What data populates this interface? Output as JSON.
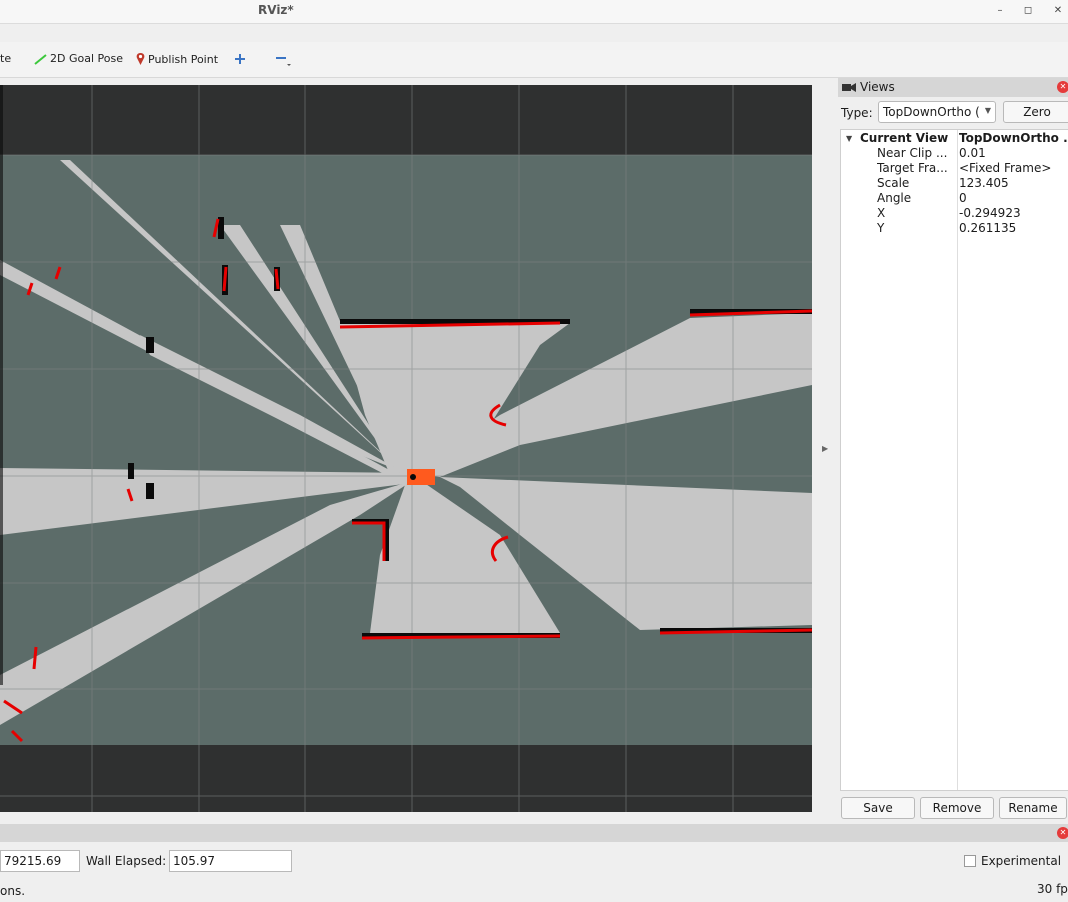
{
  "window": {
    "title": "RViz*"
  },
  "toolbar": {
    "partial_tool": "te",
    "goal_pose": "2D Goal Pose",
    "publish_point": "Publish Point"
  },
  "views_panel": {
    "title": "Views",
    "type_label": "Type:",
    "type_value": "TopDownOrtho (",
    "zero_button": "Zero",
    "properties": [
      {
        "name": "Current View",
        "value": "TopDownOrtho ...",
        "head": true
      },
      {
        "name": "Near Clip ...",
        "value": "0.01"
      },
      {
        "name": "Target Fra...",
        "value": "<Fixed Frame>"
      },
      {
        "name": "Scale",
        "value": "123.405"
      },
      {
        "name": "Angle",
        "value": "0"
      },
      {
        "name": "X",
        "value": "-0.294923"
      },
      {
        "name": "Y",
        "value": "0.261135"
      }
    ],
    "save_button": "Save",
    "remove_button": "Remove",
    "rename_button": "Rename"
  },
  "time_panel": {
    "ros_elapsed_value": "79215.69",
    "wall_elapsed_label": "Wall Elapsed:",
    "wall_elapsed_value": "105.97",
    "experimental_label": "Experimental",
    "status_text": "ons.",
    "fps": "30 fp"
  },
  "colors": {
    "viewport_bg": "#2f3030",
    "unknown_space": "#5c6c69",
    "free_space": "#c6c6c6",
    "obstacle": "#0a0a0a",
    "laser_scan": "#e60000",
    "robot": "#ff5a1e",
    "grid": "#808585"
  }
}
